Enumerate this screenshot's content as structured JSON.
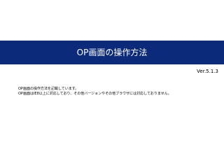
{
  "title": "OP画面の操作方法",
  "version": "Ver.5.1.3",
  "body": {
    "lines": [
      "OP画面の操作方法を記載しています。",
      "OP画面はIE8以上に対応しており、その他バージョンやその他ブラウザには対応しておりません。"
    ]
  },
  "colors": {
    "title_band": "#0b2a7a",
    "background": "#ffffff",
    "title_text": "#ffffff",
    "body_text": "#000000"
  }
}
